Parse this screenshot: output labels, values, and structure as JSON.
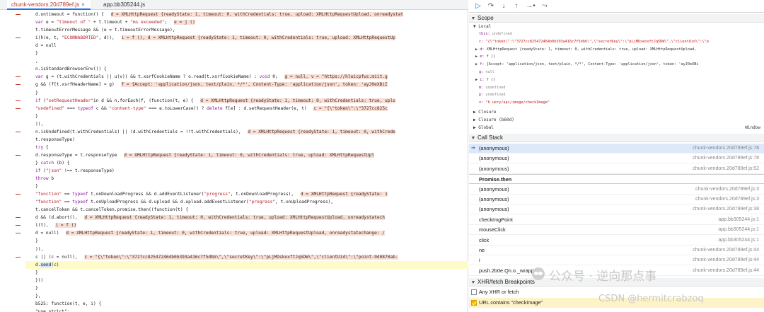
{
  "tabs": [
    {
      "label": "chunk-vendors.20d789ef.js",
      "active": true
    },
    {
      "label": "app.bb305244.js",
      "active": false
    }
  ],
  "code_lines": [
    [
      {
        "t": "d.ontimeout = function() {  ",
        "c": ""
      },
      {
        "t": "d = XMLHttpRequest  {readyState: 1, timeout: 0, withCredentials: true, upload: XMLHttpRequestUpload, onreadystat",
        "c": "inl"
      }
    ],
    [
      {
        "t": "    ",
        "c": ""
      },
      {
        "t": "var",
        "c": "kw"
      },
      {
        "t": " e = ",
        "c": ""
      },
      {
        "t": "\"timeout of \"",
        "c": "str"
      },
      {
        "t": " + t.timeout + ",
        "c": ""
      },
      {
        "t": "\"ms exceeded\"",
        "c": "str"
      },
      {
        "t": ";  ",
        "c": ""
      },
      {
        "t": "e = j ()",
        "c": "inl"
      }
    ],
    [
      {
        "t": "    t.timeoutErrorMessage && (e = t.timeoutErrorMessage),",
        "c": ""
      }
    ],
    [
      {
        "t": "    i(h(e, t, ",
        "c": ""
      },
      {
        "t": "\"ECONNABORTED\"",
        "c": "str"
      },
      {
        "t": ", d)),  ",
        "c": ""
      },
      {
        "t": "i = f (),  d = XMLHttpRequest  {readyState: 1, timeout: 0, withCredentials: true, upload: XMLHttpRequestUp",
        "c": "inl"
      }
    ],
    [
      {
        "t": "    d = null",
        "c": ""
      }
    ],
    [
      {
        "t": "}",
        "c": ""
      }
    ],
    [
      {
        "t": ",",
        "c": ""
      }
    ],
    [
      {
        "t": "n.isStandardBrowserEnv()) {",
        "c": ""
      }
    ],
    [
      {
        "t": "    ",
        "c": ""
      },
      {
        "t": "var",
        "c": "kw"
      },
      {
        "t": " g = (t.withCredentials || u(v)) && t.xsrfCookieName ? o.read(t.xsrfCookieName) : ",
        "c": ""
      },
      {
        "t": "void",
        "c": "kw"
      },
      {
        "t": " 0;  ",
        "c": ""
      },
      {
        "t": "g = null,  v = \"https://hlwicpfwc.miit.g",
        "c": "inl"
      }
    ],
    [
      {
        "t": "    g && (f[t.xsrfHeaderName] = g)  ",
        "c": ""
      },
      {
        "t": "f = {Accept: 'application/json, text/plain, */*', Content-Type: 'application/json', token: 'ayJ0eXBiI",
        "c": "inl"
      }
    ],
    [
      {
        "t": "}",
        "c": ""
      }
    ],
    [
      {
        "t": "if",
        "c": "kw"
      },
      {
        "t": " (",
        "c": ""
      },
      {
        "t": "\"setRequestHeader\"",
        "c": "str"
      },
      {
        "t": "in d && n.forEach(f, (function(t, e) {  ",
        "c": ""
      },
      {
        "t": "d = XMLHttpRequest  {readyState: 1, timeout: 0, withCredentials: true, uplo",
        "c": "inl"
      }
    ],
    [
      {
        "t": "    ",
        "c": ""
      },
      {
        "t": "\"undefined\"",
        "c": "str"
      },
      {
        "t": " === ",
        "c": ""
      },
      {
        "t": "typeof",
        "c": "kw"
      },
      {
        "t": " c && ",
        "c": ""
      },
      {
        "t": "\"content-type\"",
        "c": "str"
      },
      {
        "t": " === e.toLowerCase() ? ",
        "c": ""
      },
      {
        "t": "delete",
        "c": "kw"
      },
      {
        "t": " f[e] : d.setRequestHeader(e, t)   ",
        "c": ""
      },
      {
        "t": "c = \"{\\\"token\\\":\\\"3727cc825c",
        "c": "inl"
      }
    ],
    [
      {
        "t": "}",
        "c": ""
      }
    ],
    [
      {
        "t": ")),",
        "c": ""
      }
    ],
    [
      {
        "t": "n.isUndefined(t.withCredentials) || (d.withCredentials = !!t.withCredentials),  ",
        "c": ""
      },
      {
        "t": "d = XMLHttpRequest  {readyState: 1, timeout: 0, withCrede",
        "c": "inl"
      }
    ],
    [
      {
        "t": "t.responseType)",
        "c": ""
      }
    ],
    [
      {
        "t": "    ",
        "c": ""
      },
      {
        "t": "try",
        "c": "kw"
      },
      {
        "t": " {",
        "c": ""
      }
    ],
    [
      {
        "t": "        d.responseType = t.responseType  ",
        "c": ""
      },
      {
        "t": "d = XMLHttpRequest  {readyState: 1, timeout: 0, withCredentials: true, upload: XMLHttpRequestUpl",
        "c": "inl"
      }
    ],
    [
      {
        "t": "    } ",
        "c": ""
      },
      {
        "t": "catch",
        "c": "kw"
      },
      {
        "t": " (b) {",
        "c": ""
      }
    ],
    [
      {
        "t": "        ",
        "c": ""
      },
      {
        "t": "if",
        "c": "kw"
      },
      {
        "t": " (",
        "c": ""
      },
      {
        "t": "\"json\"",
        "c": "str"
      },
      {
        "t": " !== t.responseType)",
        "c": ""
      }
    ],
    [
      {
        "t": "            ",
        "c": ""
      },
      {
        "t": "throw",
        "c": "kw"
      },
      {
        "t": " b",
        "c": ""
      }
    ],
    [
      {
        "t": "    }",
        "c": ""
      }
    ],
    [
      {
        "t": "\"function\"",
        "c": "str"
      },
      {
        "t": " == ",
        "c": ""
      },
      {
        "t": "typeof",
        "c": "kw"
      },
      {
        "t": " t.onDownloadProgress && d.addEventListener(",
        "c": ""
      },
      {
        "t": "\"progress\"",
        "c": "str"
      },
      {
        "t": ", t.onDownloadProgress),  ",
        "c": ""
      },
      {
        "t": "d = XMLHttpRequest  {readyState: 1",
        "c": "inl"
      }
    ],
    [
      {
        "t": "\"function\"",
        "c": "str"
      },
      {
        "t": " == ",
        "c": ""
      },
      {
        "t": "typeof",
        "c": "kw"
      },
      {
        "t": " t.onUploadProgress && d.upload && d.upload.addEventListener(",
        "c": ""
      },
      {
        "t": "\"progress\"",
        "c": "str"
      },
      {
        "t": ", t.onUploadProgress),",
        "c": ""
      }
    ],
    [
      {
        "t": "t.cancelToken && t.cancelToken.promise.then((function(t) {",
        "c": ""
      }
    ],
    [
      {
        "t": "    d && (d.abort(),  ",
        "c": ""
      },
      {
        "t": "d = XMLHttpRequest  {readyState: 1, timeout: 0, withCredentials: true, upload: XMLHttpRequestUpload, onreadystatech",
        "c": "inl"
      }
    ],
    [
      {
        "t": "    i(t),  ",
        "c": ""
      },
      {
        "t": "i = f ()",
        "c": "inl"
      }
    ],
    [
      {
        "t": "    d = null)  ",
        "c": ""
      },
      {
        "t": "d = XMLHttpRequest  {readyState: 1, timeout: 0, withCredentials: true, upload: XMLHttpRequestUpload, onreadystatechange: /",
        "c": "inl"
      }
    ],
    [
      {
        "t": "}",
        "c": ""
      }
    ],
    [
      {
        "t": ")),",
        "c": ""
      }
    ],
    [
      {
        "t": "c || (c = null),  ",
        "c": ""
      },
      {
        "t": "c = \"{\\\"token\\\":\\\"3727cc825472464b0b393a416c7f5dbb\\\",\\\"secretKey\\\":\\\"pLjMOskoxftJq5DW\\\",\\\"clientUid\\\":\\\"point-9d0870ab-",
        "c": "inl"
      }
    ],
    [
      {
        "t": "d.",
        "c": ""
      },
      {
        "t": "send",
        "c": "sel"
      },
      {
        "t": "(c)",
        "c": ""
      }
    ],
    [
      {
        "t": "}",
        "c": ""
      }
    ],
    [
      {
        "t": "}))",
        "c": ""
      }
    ],
    [
      {
        "t": "}",
        "c": ""
      }
    ],
    [
      {
        "t": "},",
        "c": ""
      }
    ],
    [
      {
        "t": "b525: function(t, e, i) {",
        "c": ""
      }
    ],
    [
      {
        "t": "    \"use strict\";",
        "c": ""
      }
    ]
  ],
  "debugger_toolbar": {
    "resume": "▷",
    "step_over": "↷",
    "step_into": "↓",
    "step_out": "↑",
    "step": "→•",
    "deactivate": "⤳"
  },
  "scope": {
    "title": "Scope",
    "local_title": "Local",
    "local_vars": [
      {
        "name": "this",
        "value": "undefined",
        "vc": "vgray"
      },
      {
        "name": "c",
        "value": "\"{\\\"token\\\":\\\"3727cc825472464b0b393a416c7f5dbb\\\",\\\"secretKey\\\":\\\"pLjMOskoxftJq5DW\\\",\\\"clientUid\\\":\\\"p",
        "vc": "vstr"
      },
      {
        "name": "d",
        "value": "XMLHttpRequest  {readyState: 1, timeout: 0, withCredentials: true, upload: XMLHttpRequestUpload,",
        "vc": ""
      },
      {
        "name": "e",
        "value": "f ()",
        "vc": ""
      },
      {
        "name": "f",
        "value": "{Accept: 'application/json, text/plain, */*', Content-Type: 'application/json', token: 'ayJ0eXBi",
        "vc": ""
      },
      {
        "name": "g",
        "value": "null",
        "vc": "vgray"
      },
      {
        "name": "i",
        "value": "f ()",
        "vc": ""
      },
      {
        "name": "m",
        "value": "undefined",
        "vc": "vgray"
      },
      {
        "name": "p",
        "value": "undefined",
        "vc": "vgray"
      },
      {
        "name": "v",
        "value": "\"h                                   uery/api/image/checkImage\"",
        "vc": "vstr"
      }
    ],
    "closure_1": "Closure",
    "closure_2": "Closure (b60d)",
    "global": "Global",
    "global_value": "Window"
  },
  "call_stack": {
    "title": "Call Stack",
    "frames": [
      {
        "fn": "(anonymous)",
        "loc": "chunk-vendors.20d789ef.js:78",
        "current": true
      },
      {
        "fn": "(anonymous)",
        "loc": "chunk-vendors.20d789ef.js:78",
        "current": false
      },
      {
        "fn": "(anonymous)",
        "loc": "chunk-vendors.20d789ef.js:52",
        "current": false
      },
      {
        "fn": "Promise.then",
        "loc": "",
        "async": true
      },
      {
        "fn": "(anonymous)",
        "loc": "chunk-vendors.20d789ef.js:3",
        "current": false
      },
      {
        "fn": "(anonymous)",
        "loc": "chunk-vendors.20d789ef.js:3",
        "current": false
      },
      {
        "fn": "(anonymous)",
        "loc": "chunk-vendors.20d789ef.js:38",
        "current": false
      },
      {
        "fn": "checkImgPoint",
        "loc": "app.bb305244.js:1",
        "current": false
      },
      {
        "fn": "mouseClick",
        "loc": "app.bb305244.js:1",
        "current": false
      },
      {
        "fn": "click",
        "loc": "app.bb305244.js:1",
        "current": false
      },
      {
        "fn": "ne",
        "loc": "chunk-vendors.20d789ef.js:44",
        "current": false
      },
      {
        "fn": "i",
        "loc": "chunk-vendors.20d789ef.js:44",
        "current": false
      },
      {
        "fn": "push.2b0e.Qn.o._wrapper",
        "loc": "chunk-vendors.20d789ef.js:44",
        "current": false
      }
    ]
  },
  "xhr_breakpoints": {
    "title": "XHR/fetch Breakpoints",
    "items": [
      {
        "label": "Any XHR or fetch",
        "checked": false
      },
      {
        "label": "URL contains \"checkImage\"",
        "checked": true
      }
    ]
  },
  "watermark": {
    "line1": "公众号 · 逆向那点事",
    "line2": "CSDN @hermitcrabzoq"
  }
}
